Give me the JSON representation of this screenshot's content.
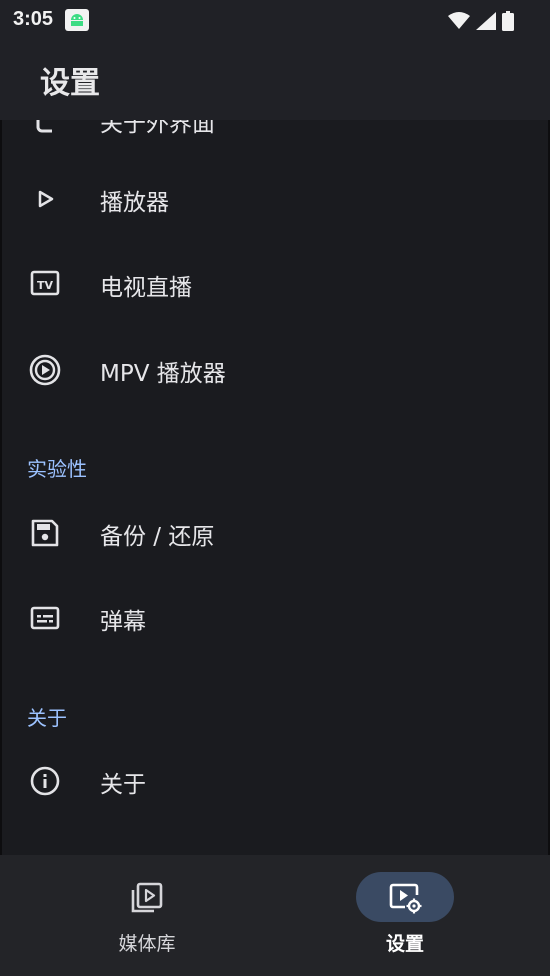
{
  "status_bar": {
    "time": "3:05",
    "icons": [
      "android-app-icon",
      "wifi-icon",
      "cellular-signal-icon",
      "battery-icon"
    ]
  },
  "app_bar": {
    "title": "设置"
  },
  "settings": {
    "items": [
      {
        "label": "关于外界面",
        "icon": "customize-icon"
      },
      {
        "label": "播放器",
        "icon": "play-icon"
      },
      {
        "label": "电视直播",
        "icon": "tv-icon"
      },
      {
        "label": "MPV 播放器",
        "icon": "mpv-icon"
      }
    ],
    "sections": [
      {
        "header": "实验性",
        "items": [
          {
            "label": "备份 / 还原",
            "icon": "save-icon"
          },
          {
            "label": "弹幕",
            "icon": "subtitles-icon"
          }
        ]
      },
      {
        "header": "关于",
        "items": [
          {
            "label": "关于",
            "icon": "info-icon"
          }
        ]
      }
    ]
  },
  "bottom_nav": {
    "items": [
      {
        "label": "媒体库",
        "icon": "library-icon",
        "active": false
      },
      {
        "label": "设置",
        "icon": "settings-video-icon",
        "active": true
      }
    ]
  },
  "colors": {
    "background": "#1a1b1f",
    "app_bar": "#202126",
    "section_header": "#9cc2ff",
    "nav_active_pill": "#3a4a63"
  }
}
